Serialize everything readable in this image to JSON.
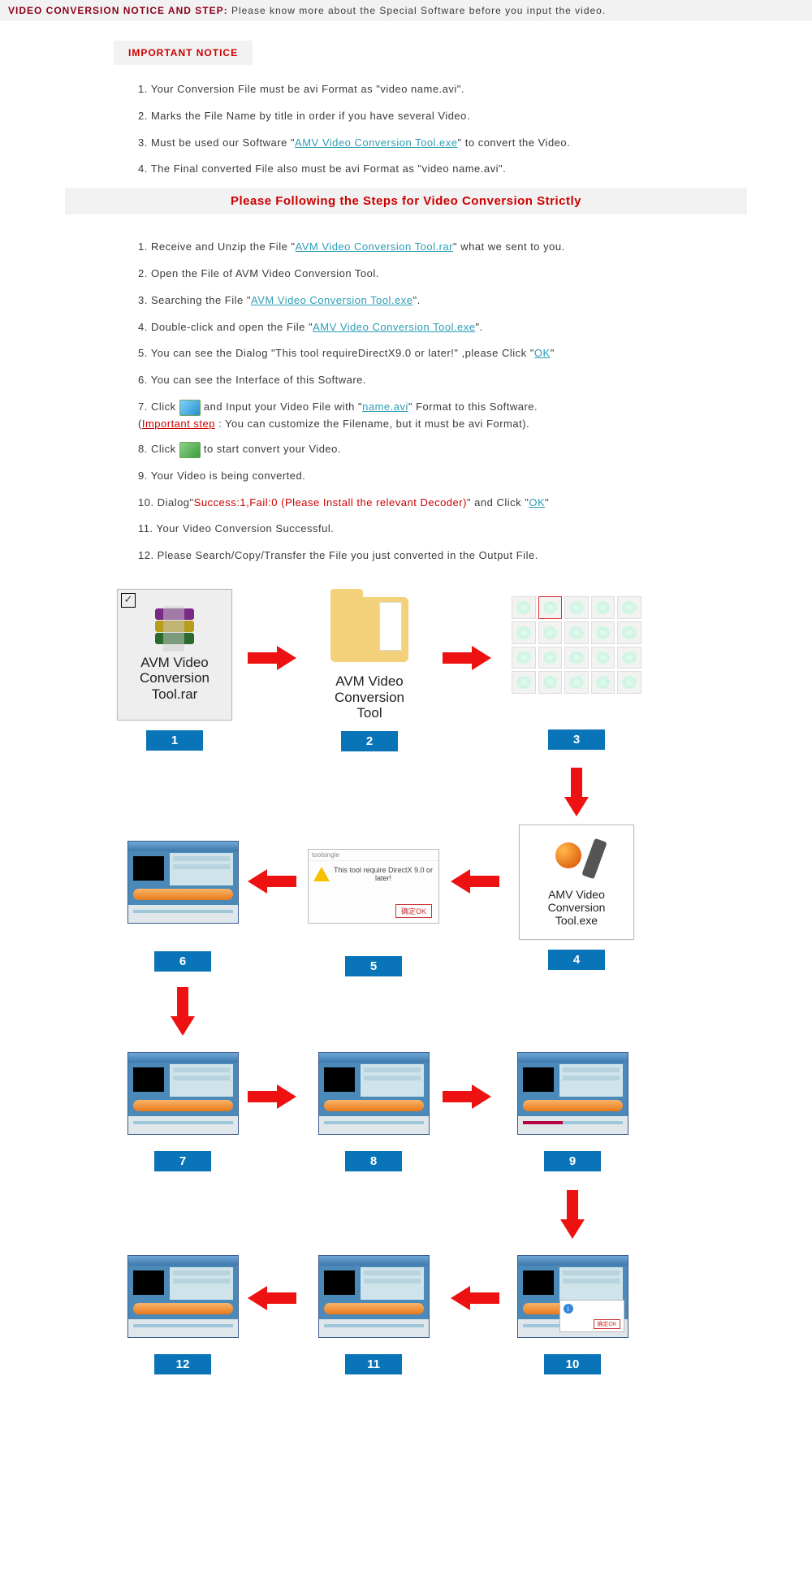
{
  "top": {
    "title": "VIDEO CONVERSION NOTICE AND STEP:",
    "sub": "Please know more about the Special Software before you input the video."
  },
  "important": "IMPORTANT NOTICE",
  "notice_items": {
    "n1a": "1. Your Conversion File  must be avi Format as \"video name.avi\".",
    "n2a": "2. Marks the File Name by title in order if you have several Video.",
    "n3a": "3. Must be used our Software \"",
    "n3b": "AMV Video Conversion Tool.exe",
    "n3c": "\" to convert the Video.",
    "n4a": "4. The Final converted File also must be avi Format as \"video name.avi\"."
  },
  "banner": "Please Following the Steps for Video Conversion Strictly",
  "steps": {
    "s1a": "1. Receive and Unzip the File \"",
    "s1b": "AVM Video Conversion Tool.rar",
    "s1c": "\" what we sent to you.",
    "s2": "2. Open the File of AVM Video Conversion Tool.",
    "s3a": "3. Searching the File \"",
    "s3b": "AVM Video Conversion Tool.exe",
    "s3c": "\".",
    "s4a": "4. Double-click and open the File \"",
    "s4b": "AMV Video Conversion Tool.exe",
    "s4c": "\".",
    "s5a": "5. You can see the Dialog \"This tool requireDirectX9.0 or later!\" ,please Click \"",
    "s5b": "OK",
    "s5c": "\"",
    "s6": "6. You can see the Interface of this Software.",
    "s7a": "7. Click",
    "s7b": " and Input your Video File with \"",
    "s7c": "name.avi",
    "s7d": "\" Format to this Software.",
    "s7e": "(",
    "s7f": "Important step",
    "s7g": " : You can customize the Filename, but it must be avi Format).",
    "s8a": "8. Click",
    "s8b": " to start convert your Video.",
    "s9": "9. Your Video is being converted.",
    "s10a": "10. Dialog\"",
    "s10b": "Success:1,Fail:0 (Please Install the relevant Decoder)",
    "s10c": "\" and Click \"",
    "s10d": "OK",
    "s10e": "\"",
    "s11": "11. Your Video Conversion Successful.",
    "s12": "12. Please Search/Copy/Transfer the File you just converted in the Output File."
  },
  "diagram": {
    "rar": "AVM Video\nConversion\nTool.rar",
    "folder": "AVM Video\nConversion\nTool",
    "exe": "AMV Video\nConversion\nTool.exe",
    "msgbox_title": "toolsingle",
    "msgbox_text": "This tool require DirectX 9.0 or later!",
    "msgbox_ok": "确定OK",
    "info_i": "i",
    "n1": "1",
    "n2": "2",
    "n3": "3",
    "n4": "4",
    "n5": "5",
    "n6": "6",
    "n7": "7",
    "n8": "8",
    "n9": "9",
    "n10": "10",
    "n11": "11",
    "n12": "12",
    "check": "✓"
  }
}
